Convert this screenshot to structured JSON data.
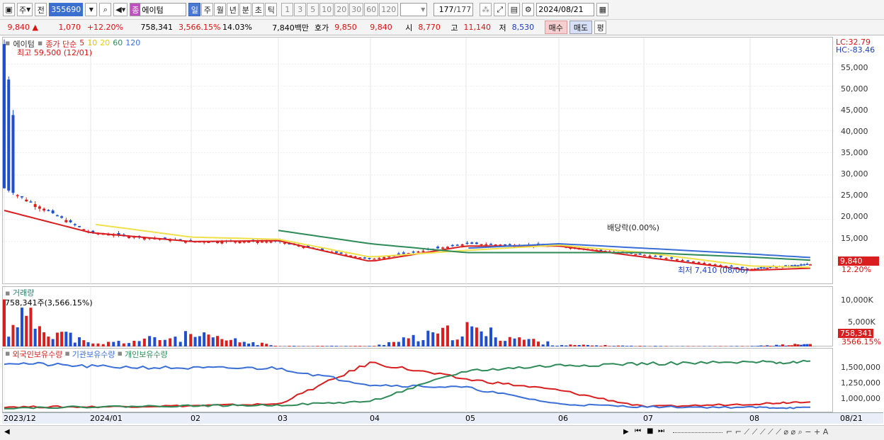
{
  "toolbar": {
    "market": "주",
    "prev": "전",
    "code": "355690",
    "name_badge": "종",
    "name": "에이텀",
    "periods": [
      "일",
      "주",
      "월",
      "년",
      "분",
      "초",
      "틱"
    ],
    "intervals": [
      "1",
      "3",
      "5",
      "10",
      "20",
      "30",
      "60",
      "120"
    ],
    "count": "177",
    "total": "/177",
    "date": "2024/08/21"
  },
  "quote": {
    "price": "9,840",
    "arrow": "▲",
    "change": "1,070",
    "rate": "+12.20%",
    "volume": "758,341",
    "vol_rate": "3,566.15%",
    "turnover": "14.03%",
    "amount": "7,840백만",
    "bid_label": "호가",
    "bid1": "9,850",
    "bid2": "9,840",
    "open_label": "시",
    "open": "8,770",
    "high_label": "고",
    "high": "11,140",
    "low_label": "저",
    "low": "8,530",
    "buy": "매수",
    "sell": "매도",
    "avg": "평"
  },
  "price_panel": {
    "name": "에이텀",
    "ma_label": "종가 단순",
    "ma_periods": [
      "5",
      "10",
      "20",
      "60",
      "120"
    ],
    "ma_colors": [
      "#d81e1e",
      "#e6c000",
      "#f0e04a",
      "#2e8b57",
      "#3a6fd8"
    ],
    "lc": "LC:32.79",
    "hc": "HC:-83.46",
    "max_note": "최고 59,500 (12/01)",
    "min_note": "최저 7,410 (08/06)",
    "dividend_note": "배당락(0.00%)",
    "last_price": "9,840",
    "last_rate": "12.20%",
    "y_ticks": [
      "55,000",
      "50,000",
      "45,000",
      "40,000",
      "35,000",
      "30,000",
      "25,000",
      "20,000",
      "15,000"
    ]
  },
  "volume_panel": {
    "title": "거래량",
    "note": "758,341주(3,566.15%)",
    "y_ticks": [
      "10,000K",
      "5,000K"
    ],
    "last": "758,341",
    "last_rate": "3566.15%"
  },
  "holding_panel": {
    "titles": [
      "외국인보유수량",
      "기관보유수량",
      "개인보유수량"
    ],
    "colors": [
      "#d81e1e",
      "#3a6fd8",
      "#2e8b57"
    ],
    "y_ticks": [
      "1,500,000",
      "1,250,000",
      "1,000,000"
    ]
  },
  "x_axis": {
    "labels": [
      "2023/12",
      "2024/01",
      "02",
      "03",
      "04",
      "05",
      "06",
      "07",
      "08"
    ],
    "end_label": "08/21"
  },
  "chart_data": [
    {
      "type": "candlestick",
      "title": "에이텀",
      "x": [
        "2023/12",
        "2024/01",
        "02",
        "03",
        "04",
        "05",
        "06",
        "07",
        "08",
        "08/21"
      ],
      "close_approx": [
        27000,
        17000,
        15000,
        15000,
        11000,
        14500,
        14000,
        12000,
        8800,
        9840
      ],
      "series": [
        {
          "name": "5",
          "values": [
            22000,
            17000,
            15000,
            15200,
            10500,
            14000,
            14000,
            11500,
            8500,
            9000
          ]
        },
        {
          "name": "20",
          "values": [
            null,
            19000,
            16000,
            15500,
            11500,
            13000,
            14200,
            12500,
            9500,
            9200
          ]
        },
        {
          "name": "60",
          "values": [
            null,
            null,
            null,
            17500,
            14500,
            12500,
            12500,
            12500,
            11500,
            10800
          ]
        },
        {
          "name": "120",
          "values": [
            null,
            null,
            null,
            null,
            null,
            13500,
            14500,
            13500,
            12200,
            11400
          ]
        }
      ],
      "ylim": [
        7000,
        60000
      ]
    },
    {
      "type": "bar",
      "title": "거래량",
      "x": [
        "2023/12",
        "2024/01",
        "02",
        "03",
        "04",
        "05",
        "06",
        "07",
        "08",
        "08/21"
      ],
      "values_k": [
        12000,
        700,
        3500,
        200,
        150,
        5600,
        500,
        150,
        100,
        758.341
      ]
    },
    {
      "type": "line",
      "series": [
        {
          "name": "외국인보유수량",
          "values": [
            800000,
            800000,
            820000,
            850000,
            1600000,
            1300000,
            1100000,
            800000,
            850000,
            900000
          ]
        },
        {
          "name": "기관보유수량",
          "values": [
            1600000,
            1530000,
            1500000,
            1500000,
            1200000,
            1150000,
            850000,
            800000,
            790000,
            780000
          ]
        },
        {
          "name": "개인보유수량",
          "values": [
            780000,
            800000,
            820000,
            830000,
            900000,
            1450000,
            1550000,
            1580000,
            1600000,
            1620000
          ]
        }
      ]
    }
  ],
  "status": {
    "nav": [
      "◀",
      "▶",
      "⏮",
      "■",
      "⏭"
    ]
  }
}
